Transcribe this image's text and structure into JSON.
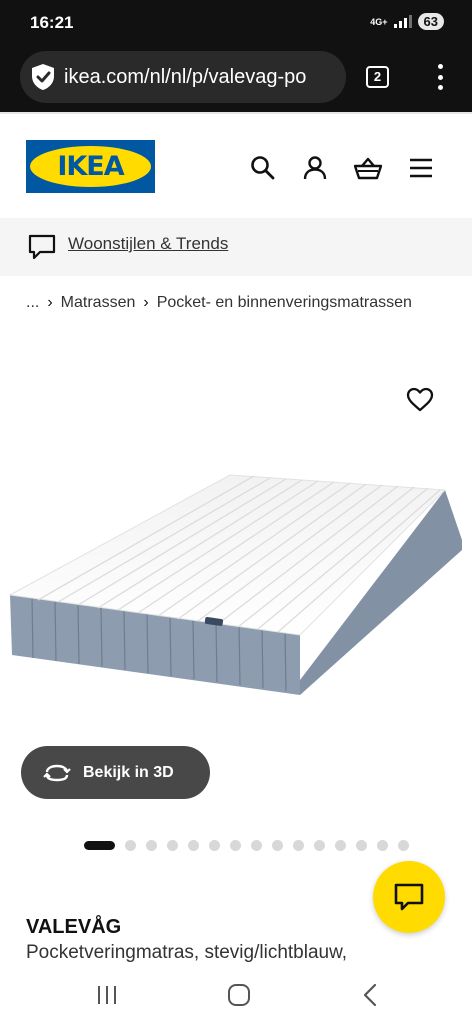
{
  "status_bar": {
    "time": "16:21",
    "network": "4G+",
    "battery": "63"
  },
  "browser": {
    "url": "ikea.com/nl/nl/p/valevag-po",
    "tab_count": "2"
  },
  "header": {
    "logo_text": "IKEA"
  },
  "inspiration": {
    "link_label": "Woonstijlen & Trends"
  },
  "breadcrumb": {
    "ellipsis": "...",
    "items": [
      "Matrassen",
      "Pocket- en binnenveringsmatrassen"
    ]
  },
  "product": {
    "view_3d_label": "Bekijk in 3D",
    "name": "VALEVÅG",
    "description": "Pocketveringmatras, stevig/lichtblauw,",
    "image_count": 15,
    "active_image": 1
  },
  "icons": {
    "shield": "shield-icon",
    "search": "search-icon",
    "account": "user-icon",
    "basket": "basket-icon",
    "menu": "hamburger-menu-icon",
    "chat": "chat-bubble-icon",
    "favourite": "heart-icon",
    "rotate3d": "rotate-3d-icon"
  },
  "colors": {
    "ikea_blue": "#0058a3",
    "ikea_yellow": "#ffdb00",
    "mattress_border": "#7f8ea3"
  }
}
